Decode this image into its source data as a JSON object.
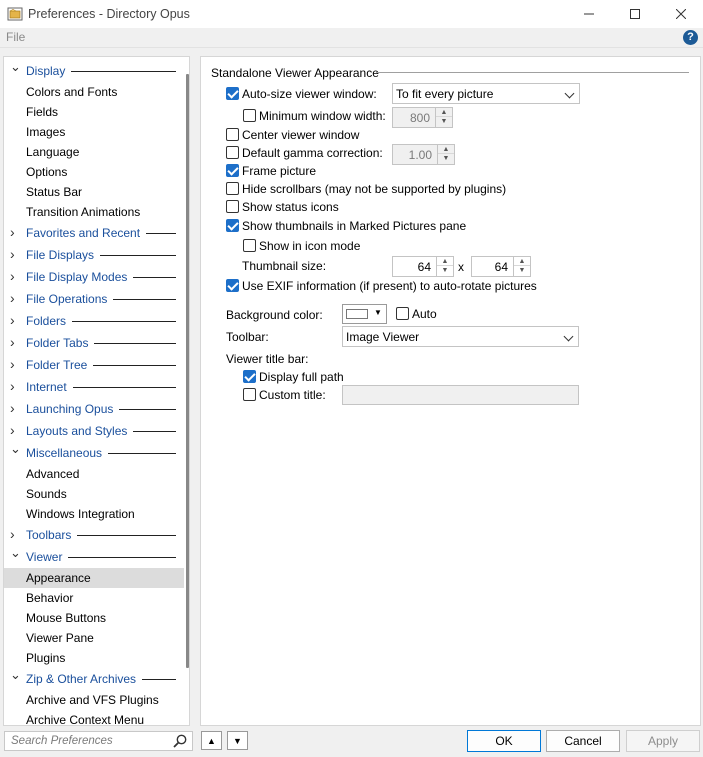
{
  "window": {
    "title": "Preferences - Directory Opus"
  },
  "menu": {
    "file": "File"
  },
  "tree": [
    {
      "label": "Display",
      "type": "cat",
      "expanded": true
    },
    {
      "label": "Colors and Fonts",
      "type": "child"
    },
    {
      "label": "Fields",
      "type": "child"
    },
    {
      "label": "Images",
      "type": "child"
    },
    {
      "label": "Language",
      "type": "child"
    },
    {
      "label": "Options",
      "type": "child"
    },
    {
      "label": "Status Bar",
      "type": "child"
    },
    {
      "label": "Transition Animations",
      "type": "child"
    },
    {
      "label": "Favorites and Recent",
      "type": "cat",
      "expanded": false
    },
    {
      "label": "File Displays",
      "type": "cat",
      "expanded": false
    },
    {
      "label": "File Display Modes",
      "type": "cat",
      "expanded": false
    },
    {
      "label": "File Operations",
      "type": "cat",
      "expanded": false
    },
    {
      "label": "Folders",
      "type": "cat",
      "expanded": false
    },
    {
      "label": "Folder Tabs",
      "type": "cat",
      "expanded": false
    },
    {
      "label": "Folder Tree",
      "type": "cat",
      "expanded": false
    },
    {
      "label": "Internet",
      "type": "cat",
      "expanded": false
    },
    {
      "label": "Launching Opus",
      "type": "cat",
      "expanded": false
    },
    {
      "label": "Layouts and Styles",
      "type": "cat",
      "expanded": false
    },
    {
      "label": "Miscellaneous",
      "type": "cat",
      "expanded": true
    },
    {
      "label": "Advanced",
      "type": "child"
    },
    {
      "label": "Sounds",
      "type": "child"
    },
    {
      "label": "Windows Integration",
      "type": "child"
    },
    {
      "label": "Toolbars",
      "type": "cat",
      "expanded": false
    },
    {
      "label": "Viewer",
      "type": "cat",
      "expanded": true
    },
    {
      "label": "Appearance",
      "type": "child",
      "selected": true
    },
    {
      "label": "Behavior",
      "type": "child"
    },
    {
      "label": "Mouse Buttons",
      "type": "child"
    },
    {
      "label": "Viewer Pane",
      "type": "child"
    },
    {
      "label": "Plugins",
      "type": "child"
    },
    {
      "label": "Zip & Other Archives",
      "type": "cat",
      "expanded": true
    },
    {
      "label": "Archive and VFS Plugins",
      "type": "child"
    },
    {
      "label": "Archive Context Menu",
      "type": "child"
    }
  ],
  "content": {
    "group_title": "Standalone Viewer Appearance",
    "auto_size": {
      "label": "Auto-size viewer window:",
      "checked": true
    },
    "auto_size_combo": "To fit every picture",
    "min_width": {
      "label": "Minimum window width:",
      "checked": false,
      "value": "800"
    },
    "center": {
      "label": "Center viewer window",
      "checked": false
    },
    "gamma": {
      "label": "Default gamma correction:",
      "checked": false,
      "value": "1.00"
    },
    "frame": {
      "label": "Frame picture",
      "checked": true
    },
    "hide_scroll": {
      "label": "Hide scrollbars (may not be supported by plugins)",
      "checked": false
    },
    "status_icons": {
      "label": "Show status icons",
      "checked": false
    },
    "thumbs": {
      "label": "Show thumbnails in Marked Pictures pane",
      "checked": true
    },
    "icon_mode": {
      "label": "Show in icon mode",
      "checked": false
    },
    "thumb_size": {
      "label": "Thumbnail size:",
      "w": "64",
      "x": "x",
      "h": "64"
    },
    "exif": {
      "label": "Use EXIF information (if present) to auto-rotate pictures",
      "checked": true
    },
    "bg": {
      "label": "Background color:",
      "auto_label": "Auto",
      "auto_checked": false,
      "color": "#ffffff"
    },
    "toolbar": {
      "label": "Toolbar:",
      "value": "Image Viewer"
    },
    "title_bar": {
      "label": "Viewer title bar:"
    },
    "full_path": {
      "label": "Display full path",
      "checked": true
    },
    "custom_title": {
      "label": "Custom title:",
      "checked": false
    }
  },
  "bottom": {
    "search_placeholder": "Search Preferences",
    "ok": "OK",
    "cancel": "Cancel",
    "apply": "Apply"
  }
}
